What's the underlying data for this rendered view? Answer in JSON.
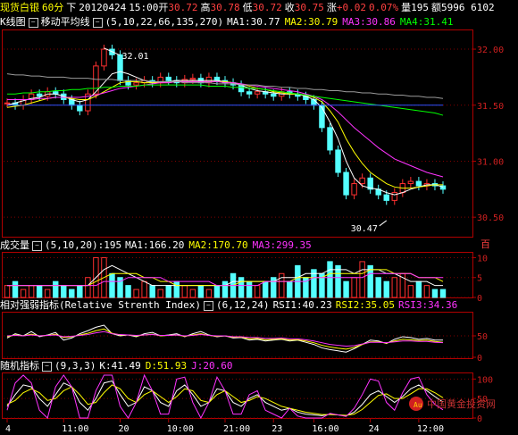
{
  "header": {
    "symbol": "现货白银",
    "period": "60分",
    "direction": "下",
    "date": "20120424",
    "time": "15:00",
    "open_label": "开",
    "open": "30.72",
    "high_label": "高",
    "high": "30.78",
    "low_label": "低",
    "low": "30.72",
    "close_label": "收",
    "close": "30.75",
    "change_label": "涨",
    "change": "+0.02",
    "pct": "0.07%",
    "volume_label": "量",
    "volume": "195",
    "amount_label": "额",
    "amount": "5996 6102"
  },
  "price_panel": {
    "tab": "K线图",
    "indicator": "移动平均线",
    "params": "(5,10,22,66,135,270)",
    "ma_labels": [
      "MA1:30.77",
      "MA2:30.79",
      "MA3:30.86",
      "MA4:31.41"
    ],
    "ma_colors": [
      "#ffffff",
      "#ffff00",
      "#ff33ff",
      "#00ff00"
    ],
    "high_marker": "32.01",
    "low_marker": "30.47"
  },
  "volume_panel": {
    "title": "成交量",
    "params": "(5,10,20)",
    "value": ":195",
    "ma_labels": [
      "MA1:166.20",
      "MA2:170.70",
      "MA3:299.35"
    ],
    "ma_colors": [
      "#ffffff",
      "#ffff00",
      "#ff33ff"
    ],
    "unit": "百"
  },
  "rsi_panel": {
    "title": "相对强弱指标(Relative Strenth Index)",
    "params": "(6,12,24)",
    "labels": [
      "RSI1:40.23",
      "RSI2:35.05",
      "RSI3:34.36"
    ],
    "colors": [
      "#ffffff",
      "#ffff00",
      "#ff33ff"
    ]
  },
  "kdj_panel": {
    "title": "随机指标",
    "params": "(9,3,3)",
    "labels": [
      "K:41.49",
      "D:51.93",
      "J:20.60"
    ],
    "colors": [
      "#ffffff",
      "#ffff00",
      "#ff33ff"
    ],
    "watermark": "中国黄金投资网"
  },
  "x_axis_labels": [
    "4",
    "11:00",
    "20",
    "10:00",
    "21:00",
    "23",
    "16:00",
    "24",
    "12:00"
  ],
  "chart_data": [
    {
      "type": "candlestick",
      "title": "现货白银 60分",
      "y_ticks": [
        30.5,
        31.0,
        31.5,
        32.0
      ],
      "ylim": [
        30.35,
        32.12
      ],
      "annotations": [
        {
          "label": "32.01",
          "value": 32.01
        },
        {
          "label": "30.47",
          "value": 30.47
        }
      ],
      "close": [
        31.52,
        31.5,
        31.55,
        31.6,
        31.58,
        31.62,
        31.6,
        31.55,
        31.5,
        31.45,
        31.6,
        31.85,
        32.0,
        31.95,
        31.72,
        31.68,
        31.7,
        31.72,
        31.7,
        31.75,
        31.72,
        31.7,
        31.73,
        31.74,
        31.7,
        31.75,
        31.72,
        31.7,
        31.68,
        31.62,
        31.6,
        31.62,
        31.6,
        31.58,
        31.62,
        31.6,
        31.58,
        31.55,
        31.5,
        31.3,
        31.1,
        30.9,
        30.7,
        30.8,
        30.85,
        30.75,
        30.7,
        30.65,
        30.72,
        30.8,
        30.82,
        30.78,
        30.8,
        30.78,
        30.75
      ],
      "ma_series": [
        {
          "name": "MA1",
          "values": [
            31.5,
            31.52,
            31.54,
            31.56,
            31.57,
            31.6,
            31.6,
            31.58,
            31.55,
            31.53,
            31.55,
            31.62,
            31.7,
            31.78,
            31.8,
            31.78,
            31.75,
            31.72,
            31.7,
            31.71,
            31.71,
            31.72,
            31.72,
            31.72,
            31.72,
            31.72,
            31.72,
            31.71,
            31.7,
            31.68,
            31.65,
            31.63,
            31.62,
            31.61,
            31.6,
            31.6,
            31.6,
            31.58,
            31.55,
            31.48,
            31.35,
            31.2,
            31.0,
            30.85,
            30.78,
            30.76,
            30.75,
            30.72,
            30.7,
            30.72,
            30.75,
            30.77,
            30.79,
            30.79,
            30.77
          ]
        },
        {
          "name": "MA2",
          "values": [
            31.48,
            31.49,
            31.5,
            31.52,
            31.54,
            31.56,
            31.57,
            31.57,
            31.56,
            31.55,
            31.55,
            31.58,
            31.62,
            31.66,
            31.7,
            31.71,
            31.71,
            31.7,
            31.7,
            31.7,
            31.7,
            31.71,
            31.71,
            31.71,
            31.71,
            31.71,
            31.71,
            31.71,
            31.7,
            31.69,
            31.67,
            31.65,
            31.64,
            31.62,
            31.61,
            31.6,
            31.6,
            31.59,
            31.57,
            31.53,
            31.45,
            31.35,
            31.2,
            31.08,
            30.98,
            30.9,
            30.85,
            30.8,
            30.77,
            30.76,
            30.76,
            30.77,
            30.78,
            30.79,
            30.79
          ]
        },
        {
          "name": "MA3",
          "values": [
            31.55,
            31.55,
            31.55,
            31.55,
            31.56,
            31.56,
            31.57,
            31.57,
            31.57,
            31.57,
            31.58,
            31.59,
            31.61,
            31.63,
            31.65,
            31.66,
            31.67,
            31.68,
            31.69,
            31.7,
            31.7,
            31.71,
            31.71,
            31.71,
            31.71,
            31.71,
            31.71,
            31.7,
            31.7,
            31.69,
            31.68,
            31.67,
            31.66,
            31.65,
            31.64,
            31.63,
            31.62,
            31.6,
            31.58,
            31.55,
            31.5,
            31.44,
            31.37,
            31.3,
            31.24,
            31.18,
            31.12,
            31.07,
            31.02,
            30.99,
            30.96,
            30.93,
            30.9,
            30.88,
            30.86
          ]
        },
        {
          "name": "MA4",
          "values": [
            31.6,
            31.6,
            31.61,
            31.61,
            31.62,
            31.62,
            31.63,
            31.63,
            31.64,
            31.64,
            31.65,
            31.65,
            31.66,
            31.66,
            31.67,
            31.67,
            31.67,
            31.68,
            31.68,
            31.68,
            31.68,
            31.68,
            31.68,
            31.68,
            31.68,
            31.67,
            31.67,
            31.67,
            31.66,
            31.66,
            31.65,
            31.65,
            31.64,
            31.63,
            31.62,
            31.61,
            31.6,
            31.59,
            31.58,
            31.57,
            31.56,
            31.55,
            31.54,
            31.53,
            31.52,
            31.51,
            31.5,
            31.49,
            31.48,
            31.47,
            31.46,
            31.45,
            31.44,
            31.43,
            31.41
          ]
        },
        {
          "name": "MA5",
          "values": [
            31.78,
            31.77,
            31.77,
            31.76,
            31.76,
            31.75,
            31.75,
            31.75,
            31.74,
            31.74,
            31.74,
            31.73,
            31.73,
            31.73,
            31.72,
            31.72,
            31.72,
            31.72,
            31.71,
            31.71,
            31.71,
            31.71,
            31.7,
            31.7,
            31.7,
            31.7,
            31.69,
            31.69,
            31.69,
            31.68,
            31.68,
            31.68,
            31.67,
            31.67,
            31.66,
            31.66,
            31.65,
            31.65,
            31.64,
            31.64,
            31.63,
            31.63,
            31.62,
            31.62,
            31.61,
            31.61,
            31.6,
            31.6,
            31.59,
            31.59,
            31.58,
            31.58,
            31.57,
            31.57,
            31.56
          ]
        },
        {
          "name": "MA6",
          "values": [
            31.5,
            31.5,
            31.5,
            31.5,
            31.5,
            31.5,
            31.5,
            31.5,
            31.5,
            31.5,
            31.5,
            31.5,
            31.5,
            31.5,
            31.5,
            31.5,
            31.5,
            31.5,
            31.5,
            31.5,
            31.5,
            31.5,
            31.5,
            31.5,
            31.5,
            31.5,
            31.5,
            31.5,
            31.5,
            31.5,
            31.5,
            31.5,
            31.5,
            31.5,
            31.5,
            31.5,
            31.5,
            31.5,
            31.5,
            31.5,
            31.5,
            31.5,
            31.5,
            31.5,
            31.5,
            31.5,
            31.5,
            31.5,
            31.5,
            31.5,
            31.5,
            31.5,
            31.5,
            31.5,
            31.5
          ]
        }
      ]
    },
    {
      "type": "bar",
      "title": "成交量",
      "y_ticks": [
        0,
        5,
        10
      ],
      "ylim": [
        0,
        11
      ],
      "values": [
        3,
        4,
        2,
        3,
        3,
        2,
        4,
        3,
        2,
        3,
        5,
        10,
        10,
        6,
        5,
        3,
        2,
        4,
        3,
        2,
        3,
        4,
        3,
        2,
        3,
        2,
        3,
        4,
        6,
        5,
        4,
        3,
        4,
        5,
        6,
        4,
        8,
        5,
        7,
        6,
        9,
        8,
        4,
        5,
        9,
        8,
        5,
        4,
        5,
        6,
        3,
        4,
        3,
        2,
        2
      ],
      "series": [
        {
          "name": "MA1",
          "values": [
            3,
            3,
            3,
            3,
            3,
            3,
            3,
            3,
            3,
            3,
            3,
            5,
            7,
            8,
            7,
            6,
            5,
            4,
            3,
            3,
            3,
            3,
            3,
            3,
            3,
            3,
            3,
            3,
            4,
            4,
            4,
            4,
            4,
            4,
            5,
            5,
            5,
            6,
            6,
            6,
            7,
            7,
            7,
            6,
            7,
            7,
            7,
            6,
            6,
            5,
            4,
            4,
            4,
            3,
            3
          ]
        },
        {
          "name": "MA2",
          "values": [
            3,
            3,
            3,
            3,
            3,
            3,
            3,
            3,
            3,
            3,
            3,
            4,
            5,
            6,
            6,
            6,
            6,
            5,
            5,
            4,
            4,
            3,
            3,
            3,
            3,
            3,
            3,
            3,
            3,
            4,
            4,
            4,
            4,
            4,
            4,
            4,
            5,
            5,
            5,
            5,
            6,
            6,
            6,
            6,
            6,
            7,
            7,
            7,
            6,
            6,
            6,
            5,
            5,
            5,
            4
          ]
        },
        {
          "name": "MA3",
          "values": [
            3,
            3,
            3,
            3,
            3,
            3,
            3,
            3,
            3,
            3,
            3,
            3,
            4,
            4,
            4,
            5,
            5,
            5,
            5,
            5,
            4,
            4,
            4,
            4,
            4,
            4,
            3,
            3,
            3,
            3,
            3,
            3,
            4,
            4,
            4,
            4,
            4,
            4,
            5,
            5,
            5,
            5,
            5,
            5,
            5,
            6,
            6,
            6,
            6,
            6,
            6,
            5,
            5,
            5,
            5
          ]
        }
      ]
    },
    {
      "type": "line",
      "title": "相对强弱指标",
      "y_ticks": [
        0,
        50
      ],
      "ylim": [
        0,
        100
      ],
      "series": [
        {
          "name": "RSI1",
          "values": [
            45,
            55,
            50,
            60,
            48,
            52,
            58,
            40,
            45,
            55,
            62,
            70,
            75,
            55,
            50,
            52,
            48,
            55,
            58,
            50,
            52,
            55,
            48,
            55,
            60,
            52,
            48,
            50,
            45,
            46,
            40,
            42,
            38,
            40,
            42,
            38,
            40,
            35,
            30,
            22,
            18,
            15,
            12,
            20,
            30,
            40,
            38,
            32,
            42,
            48,
            46,
            42,
            44,
            40,
            40
          ]
        },
        {
          "name": "RSI2",
          "values": [
            48,
            52,
            50,
            54,
            50,
            51,
            54,
            46,
            48,
            52,
            56,
            62,
            66,
            56,
            52,
            52,
            50,
            52,
            54,
            50,
            51,
            52,
            49,
            52,
            55,
            51,
            49,
            50,
            47,
            47,
            43,
            44,
            41,
            42,
            43,
            40,
            41,
            38,
            34,
            28,
            24,
            21,
            19,
            23,
            30,
            36,
            36,
            33,
            38,
            42,
            41,
            39,
            40,
            37,
            35
          ]
        },
        {
          "name": "RSI3",
          "values": [
            50,
            51,
            50,
            52,
            50,
            51,
            52,
            48,
            49,
            51,
            53,
            57,
            60,
            55,
            53,
            52,
            51,
            52,
            53,
            51,
            51,
            52,
            50,
            51,
            53,
            51,
            50,
            50,
            48,
            48,
            46,
            46,
            44,
            44,
            45,
            43,
            43,
            41,
            38,
            34,
            30,
            28,
            26,
            27,
            31,
            35,
            35,
            34,
            36,
            38,
            38,
            37,
            37,
            35,
            34
          ]
        }
      ]
    },
    {
      "type": "line",
      "title": "随机指标",
      "y_ticks": [
        0,
        50,
        100
      ],
      "ylim": [
        0,
        110
      ],
      "series": [
        {
          "name": "K",
          "values": [
            30,
            60,
            85,
            80,
            50,
            30,
            60,
            90,
            80,
            40,
            20,
            50,
            90,
            95,
            60,
            30,
            40,
            80,
            70,
            40,
            30,
            70,
            85,
            60,
            30,
            40,
            75,
            70,
            40,
            30,
            50,
            60,
            40,
            30,
            20,
            25,
            15,
            10,
            8,
            6,
            10,
            8,
            6,
            15,
            35,
            60,
            70,
            55,
            40,
            55,
            75,
            85,
            70,
            55,
            41
          ]
        },
        {
          "name": "D",
          "values": [
            35,
            45,
            65,
            75,
            65,
            45,
            50,
            70,
            80,
            60,
            35,
            40,
            65,
            85,
            75,
            50,
            40,
            60,
            70,
            55,
            40,
            55,
            75,
            70,
            45,
            40,
            60,
            70,
            55,
            40,
            45,
            55,
            50,
            40,
            30,
            25,
            20,
            15,
            12,
            9,
            9,
            8,
            7,
            10,
            22,
            40,
            58,
            62,
            50,
            50,
            62,
            75,
            75,
            65,
            52
          ]
        },
        {
          "name": "J",
          "values": [
            20,
            90,
            110,
            90,
            20,
            0,
            80,
            110,
            80,
            0,
            0,
            70,
            110,
            110,
            30,
            0,
            40,
            110,
            70,
            10,
            10,
            100,
            105,
            40,
            0,
            40,
            105,
            70,
            10,
            10,
            60,
            70,
            20,
            10,
            0,
            25,
            5,
            0,
            0,
            0,
            12,
            8,
            4,
            25,
            60,
            100,
            95,
            40,
            20,
            65,
            100,
            105,
            60,
            35,
            21
          ]
        }
      ]
    }
  ]
}
